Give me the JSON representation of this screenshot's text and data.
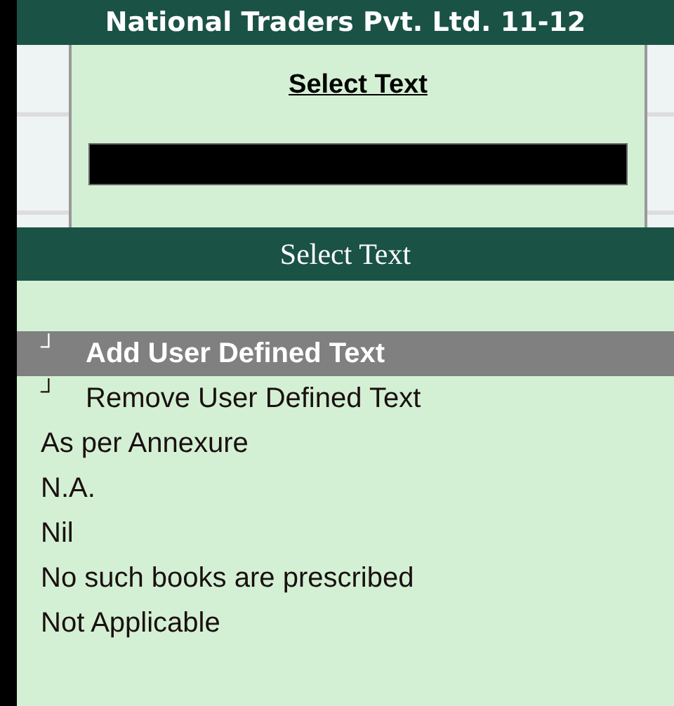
{
  "window": {
    "title": "National Traders Pvt. Ltd. 11-12"
  },
  "dialog": {
    "title": "Select Text"
  },
  "list": {
    "title": "Select Text",
    "items": [
      {
        "kind": "action",
        "marker": "┘",
        "label": "Add User Defined Text",
        "selected": true
      },
      {
        "kind": "action",
        "marker": "┘",
        "label": "Remove User Defined Text",
        "selected": false
      },
      {
        "kind": "option",
        "label": "As per Annexure",
        "selected": false
      },
      {
        "kind": "option",
        "label": "N.A.",
        "selected": false
      },
      {
        "kind": "option",
        "label": "Nil",
        "selected": false
      },
      {
        "kind": "option",
        "label": "No such books are prescribed",
        "selected": false
      },
      {
        "kind": "option",
        "label": "Not Applicable",
        "selected": false
      }
    ]
  }
}
